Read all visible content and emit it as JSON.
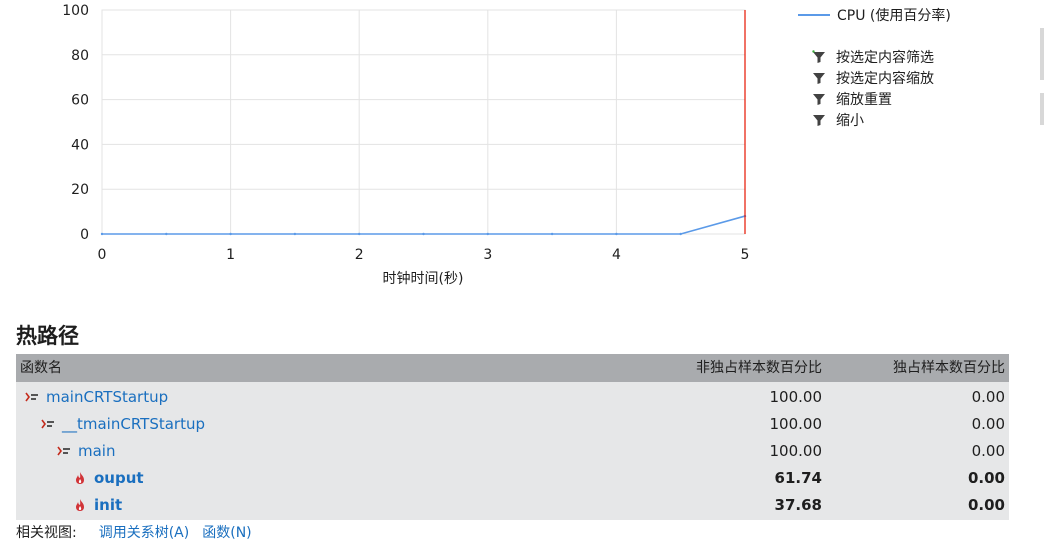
{
  "chart_data": {
    "type": "line",
    "xlabel": "时钟时间(秒)",
    "ylabel": "",
    "xlim": [
      0,
      5
    ],
    "ylim": [
      0,
      100
    ],
    "xticks": [
      "0",
      "1",
      "2",
      "3",
      "4",
      "5"
    ],
    "yticks": [
      "0",
      "20",
      "40",
      "60",
      "80",
      "100"
    ],
    "grid": true,
    "legend_position": "top-right",
    "series": [
      {
        "name": "CPU (使用百分率)",
        "color": "#5b9ae8",
        "x": [
          0,
          0.5,
          1,
          1.5,
          2,
          2.5,
          3,
          3.5,
          4,
          4.5,
          5
        ],
        "y": [
          0,
          0,
          0,
          0,
          0,
          0,
          0,
          0,
          0,
          0,
          8
        ]
      }
    ],
    "marker_line": {
      "x": 5,
      "color": "#e51400"
    }
  },
  "legend": {
    "cpu_label": "CPU (使用百分率)"
  },
  "menu": {
    "items": [
      "按选定内容筛选",
      "按选定内容缩放",
      "缩放重置",
      "缩小"
    ]
  },
  "hotpath": {
    "title": "热路径",
    "columns": [
      "函数名",
      "非独占样本数百分比",
      "独占样本数百分比"
    ],
    "rows": [
      {
        "name": "mainCRTStartup",
        "inclusive": "100.00",
        "exclusive": "0.00",
        "indent": 0,
        "icon": "call-path-icon",
        "bold": false
      },
      {
        "name": "__tmainCRTStartup",
        "inclusive": "100.00",
        "exclusive": "0.00",
        "indent": 1,
        "icon": "call-path-icon",
        "bold": false
      },
      {
        "name": "main",
        "inclusive": "100.00",
        "exclusive": "0.00",
        "indent": 2,
        "icon": "call-path-icon",
        "bold": false
      },
      {
        "name": "ouput",
        "inclusive": "61.74",
        "exclusive": "0.00",
        "indent": 3,
        "icon": "hot-flame-icon",
        "bold": true
      },
      {
        "name": "init",
        "inclusive": "37.68",
        "exclusive": "0.00",
        "indent": 3,
        "icon": "hot-flame-icon",
        "bold": true
      }
    ]
  },
  "related": {
    "label": "相关视图:",
    "links": [
      "调用关系树(A)",
      "函数(N)"
    ]
  }
}
